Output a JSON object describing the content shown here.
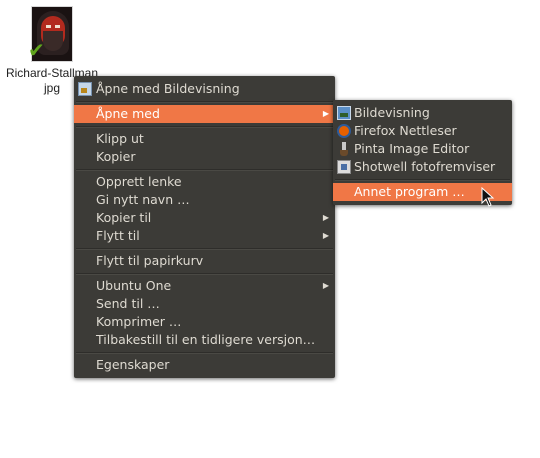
{
  "desktop": {
    "file_name_line1": "Richard-Stallman",
    "file_name_line2": "jpg"
  },
  "context_menu": {
    "items": [
      {
        "label": "Åpne med Bildevisning",
        "icon": "image-viewer-icon"
      },
      {
        "label": "Åpne med",
        "submenu": true,
        "highlighted": true
      },
      {
        "label": "Klipp ut"
      },
      {
        "label": "Kopier"
      },
      {
        "label": "Opprett lenke"
      },
      {
        "label": "Gi nytt navn …"
      },
      {
        "label": "Kopier til",
        "submenu": true
      },
      {
        "label": "Flytt til",
        "submenu": true
      },
      {
        "label": "Flytt til papirkurv"
      },
      {
        "label": "Ubuntu One",
        "submenu": true
      },
      {
        "label": "Send til …"
      },
      {
        "label": "Komprimer …"
      },
      {
        "label": "Tilbakestill til en tidligere versjon…"
      },
      {
        "label": "Egenskaper"
      }
    ]
  },
  "open_with_submenu": {
    "items": [
      {
        "label": "Bildevisning",
        "icon": "image-viewer-icon"
      },
      {
        "label": "Firefox Nettleser",
        "icon": "firefox-icon"
      },
      {
        "label": "Pinta Image Editor",
        "icon": "paintbrush-icon"
      },
      {
        "label": "Shotwell fotofremviser",
        "icon": "shotwell-icon"
      },
      {
        "label": "Annet program …",
        "highlighted": true
      }
    ]
  },
  "colors": {
    "menu_background": "#3c3b37",
    "menu_text": "#dfdbd2",
    "highlight": "#f07746"
  }
}
